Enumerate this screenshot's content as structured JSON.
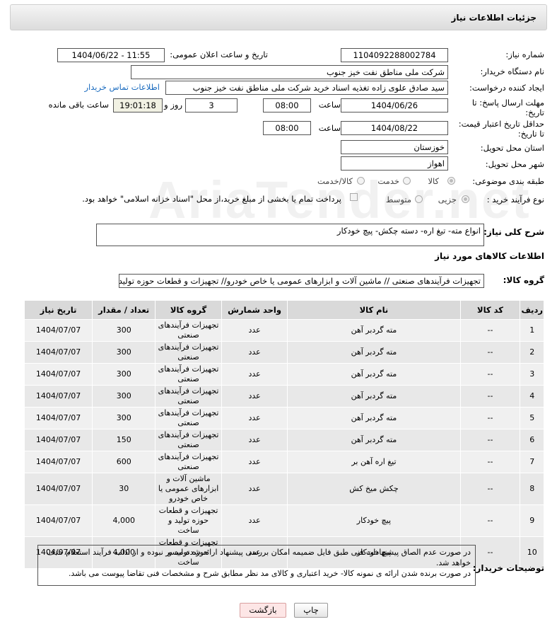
{
  "header": {
    "title": "جزئیات اطلاعات نیاز"
  },
  "fields": {
    "need_number_label": "شماره نیاز:",
    "need_number": "1104092288002784",
    "announce_label": "تاریخ و ساعت اعلان عمومی:",
    "announce_value": "1404/06/22 - 11:55",
    "buyer_label": "نام دستگاه خریدار:",
    "buyer_value": "شرکت ملی مناطق نفت خیز جنوب",
    "creator_label": "ایجاد کننده درخواست:",
    "creator_value": "سید صادق علوی زاده  تغذیه اسناد خرید  شرکت ملی مناطق نفت خیز جنوب",
    "contact_link": "اطلاعات تماس خریدار",
    "deadline_label1": "مهلت ارسال پاسخ: تا",
    "deadline_label2": "تاریخ:",
    "deadline_date": "1404/06/26",
    "time_label": "ساعت",
    "deadline_time": "08:00",
    "days_value": "3",
    "days_label": "روز و",
    "remaining_time": "19:01:18",
    "remaining_label": "ساعت باقی مانده",
    "price_label1": "حداقل تاریخ اعتبار قیمت:",
    "price_label2": "تا تاریخ:",
    "price_date": "1404/08/22",
    "price_time": "08:00",
    "province_label": "استان محل تحویل:",
    "province_value": "خوزستان",
    "city_label": "شهر محل تحویل:",
    "city_value": "اهواز",
    "category_label": "طبقه بندی موضوعی:",
    "category_options": [
      "کالا",
      "خدمت",
      "کالا/خدمت"
    ],
    "process_label": "نوع فرآیند خرید :",
    "process_options": [
      "جزیی",
      "متوسط"
    ],
    "payment_note": "پرداخت تمام یا بخشی از مبلغ خرید،از محل \"اسناد خزانه اسلامی\" خواهد بود.",
    "description_label": "شرح کلی نیاز:",
    "description_value": "انواع مته- تیغ اره- دسته چکش- پیچ خودکار",
    "goods_info_title": "اطلاعات کالاهای مورد نیاز",
    "goods_group_label": "گروه کالا:",
    "goods_group_value": "تجهیزات فرآیندهای صنعتی //  ماشین آلات و ابزارهای عمومی یا خاص خودرو// تجهیزات و قطعات حوزه تولید و"
  },
  "table": {
    "headers": [
      "ردیف",
      "کد کالا",
      "نام کالا",
      "واحد شمارش",
      "گروه کالا",
      "تعداد / مقدار",
      "تاریخ نیاز"
    ],
    "rows": [
      {
        "row": "1",
        "code": "--",
        "name": "مته گردبر آهن",
        "unit": "عدد",
        "group": "تجهیزات فرآیندهای صنعتی",
        "qty": "300",
        "date": "1404/07/07"
      },
      {
        "row": "2",
        "code": "--",
        "name": "مته گردبر آهن",
        "unit": "عدد",
        "group": "تجهیزات فرآیندهای صنعتی",
        "qty": "300",
        "date": "1404/07/07"
      },
      {
        "row": "3",
        "code": "--",
        "name": "مته گردبر آهن",
        "unit": "عدد",
        "group": "تجهیزات فرآیندهای صنعتی",
        "qty": "300",
        "date": "1404/07/07"
      },
      {
        "row": "4",
        "code": "--",
        "name": "مته گردبر آهن",
        "unit": "عدد",
        "group": "تجهیزات فرآیندهای صنعتی",
        "qty": "300",
        "date": "1404/07/07"
      },
      {
        "row": "5",
        "code": "--",
        "name": "مته گردبر آهن",
        "unit": "عدد",
        "group": "تجهیزات فرآیندهای صنعتی",
        "qty": "300",
        "date": "1404/07/07"
      },
      {
        "row": "6",
        "code": "--",
        "name": "مته گردبر آهن",
        "unit": "عدد",
        "group": "تجهیزات فرآیندهای صنعتی",
        "qty": "150",
        "date": "1404/07/07"
      },
      {
        "row": "7",
        "code": "--",
        "name": "تیغ اره آهن بر",
        "unit": "عدد",
        "group": "تجهیزات فرآیندهای صنعتی",
        "qty": "600",
        "date": "1404/07/07"
      },
      {
        "row": "8",
        "code": "--",
        "name": "چکش میخ کش",
        "unit": "عدد",
        "group": "ماشین آلات و ابزارهای عمومی یا خاص خودرو",
        "qty": "30",
        "date": "1404/07/07"
      },
      {
        "row": "9",
        "code": "--",
        "name": "پیچ خودکار",
        "unit": "عدد",
        "group": "تجهیزات و قطعات حوزه تولید و ساخت",
        "qty": "4,000",
        "date": "1404/07/07"
      },
      {
        "row": "10",
        "code": "--",
        "name": "پیچ خودکار",
        "unit": "عدد",
        "group": "تجهیزات و قطعات حوزه تولید و ساخت",
        "qty": "4,000",
        "date": "1404/07/07"
      }
    ]
  },
  "notes": {
    "label": "توضیحات خریدار:",
    "line1": "در صورت عدم الصاق پیشنهادات فنی طبق فایل ضمیمه امکان بررسی پیشنهاد ارائه شده میسر نبوده و از ادامه فرآیند استعلام حذف خواهد شد.",
    "line2": "در صورت برنده شدن ارائه ی نمونه کالا- خرید اعتباری و کالای مد نظر مطابق شرح و مشخصات فنی تقاضا پیوست می باشد."
  },
  "buttons": {
    "print": "چاپ",
    "back": "بازگشت"
  },
  "watermark": "AriaTender.net"
}
